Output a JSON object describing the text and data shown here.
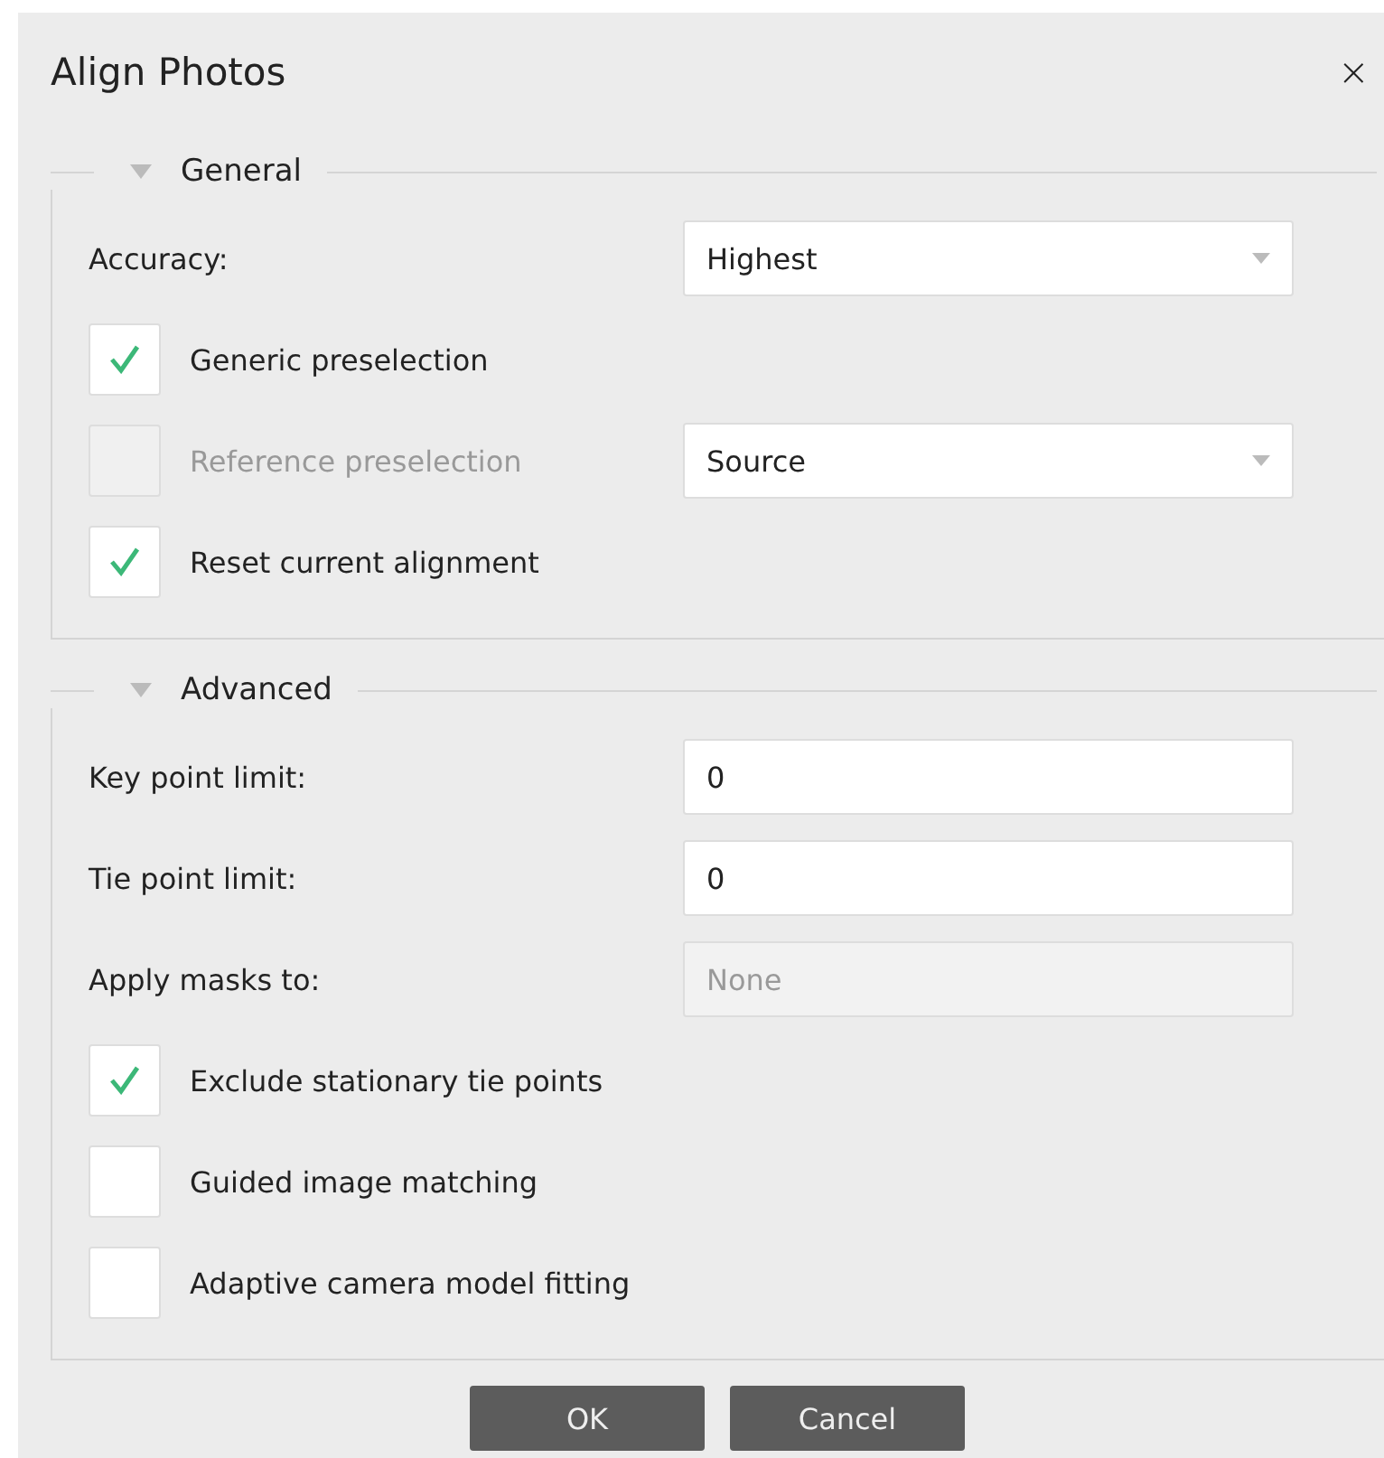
{
  "window": {
    "title": "Align Photos",
    "close": "×"
  },
  "sections": [
    {
      "title": "General",
      "expanded": true,
      "rows": [
        {
          "kind": "combo",
          "label": "Accuracy:",
          "value": "Highest",
          "disabled": false
        },
        {
          "kind": "checkbox",
          "label": "Generic preselection",
          "checked": true,
          "disabled": false
        },
        {
          "kind": "checkbox",
          "label": "Reference preselection",
          "checked": false,
          "disabled": true,
          "combo": {
            "value": "Source",
            "disabled": false
          }
        },
        {
          "kind": "checkbox",
          "label": "Reset current alignment",
          "checked": true,
          "disabled": false
        }
      ]
    },
    {
      "title": "Advanced",
      "expanded": true,
      "rows": [
        {
          "kind": "text",
          "label": "Key point limit:",
          "value": "0"
        },
        {
          "kind": "text",
          "label": "Tie point limit:",
          "value": "0"
        },
        {
          "kind": "combo",
          "label": "Apply masks to:",
          "value": "None",
          "disabled": true
        },
        {
          "kind": "checkbox",
          "label": "Exclude stationary tie points",
          "checked": true,
          "disabled": false
        },
        {
          "kind": "checkbox",
          "label": "Guided image matching",
          "checked": false,
          "disabled": false
        },
        {
          "kind": "checkbox",
          "label": "Adaptive camera model fitting",
          "checked": false,
          "disabled": false
        }
      ]
    }
  ],
  "buttons": [
    "OK",
    "Cancel"
  ]
}
